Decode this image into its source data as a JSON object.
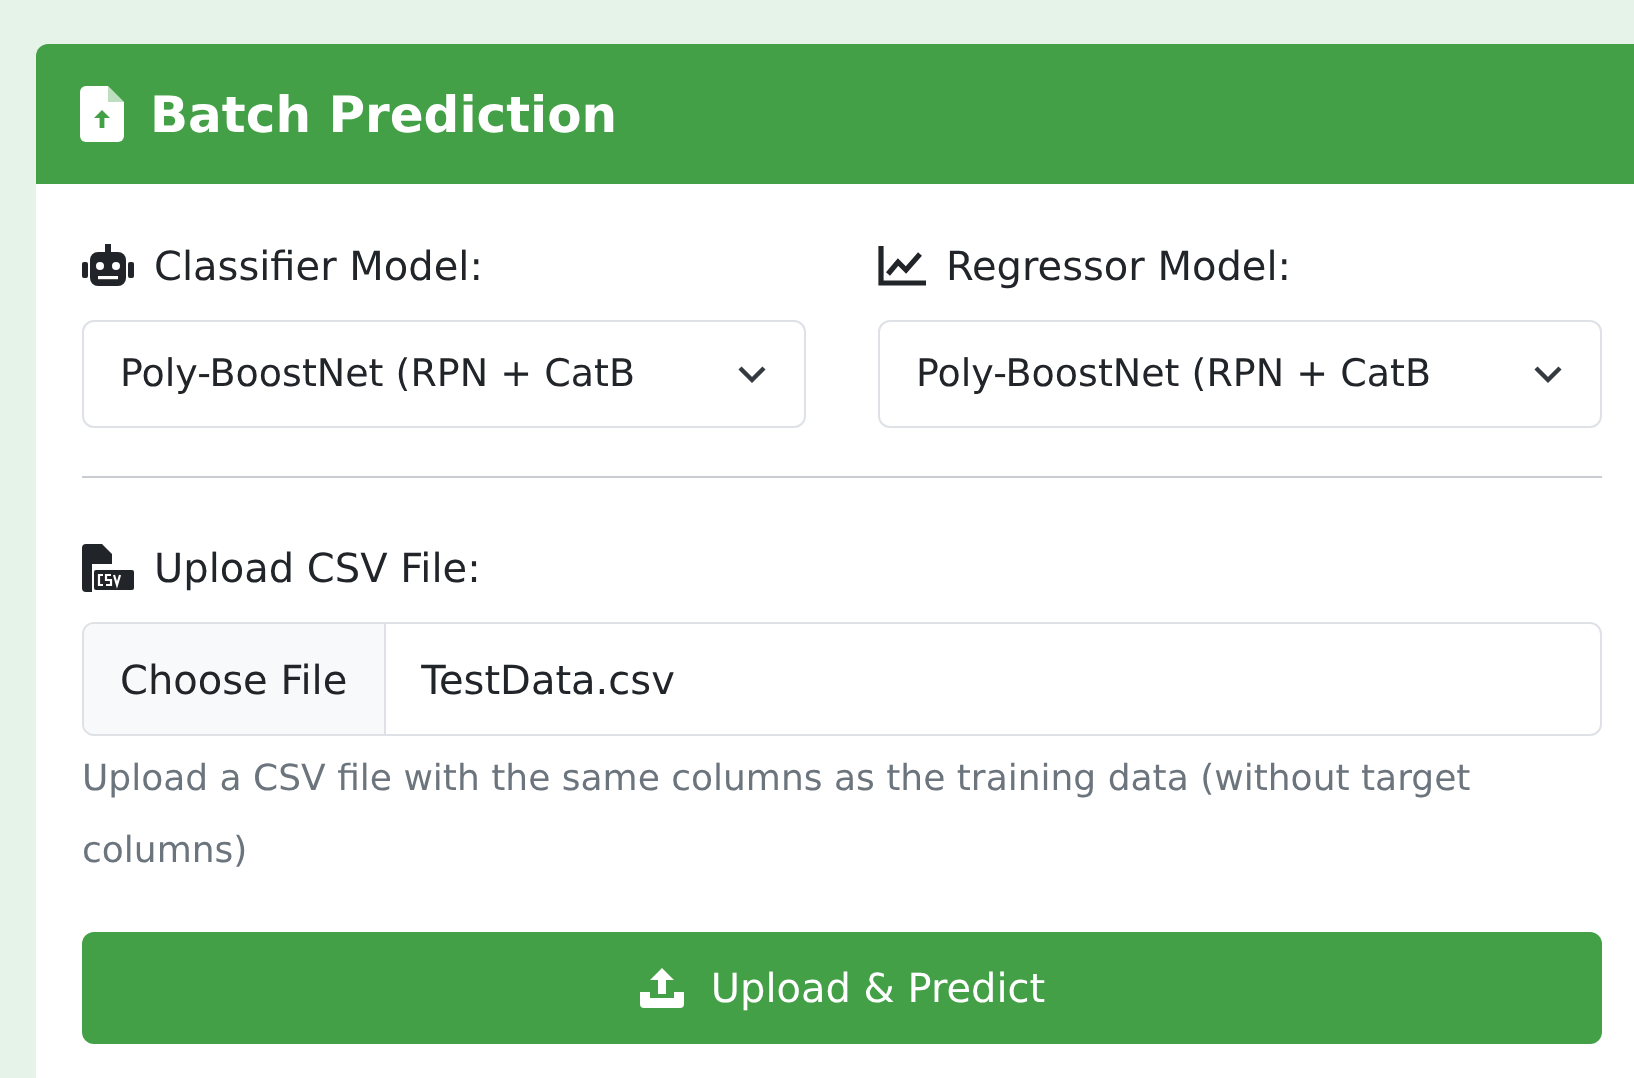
{
  "card": {
    "title": "Batch Prediction"
  },
  "selects": [
    {
      "label": "Classifier Model:",
      "value": "Poly-BoostNet (RPN + CatB"
    },
    {
      "label": "Regressor Model:",
      "value": "Poly-BoostNet (RPN + CatB"
    }
  ],
  "upload": {
    "label": "Upload CSV File:",
    "button": "Choose File",
    "value": "TestData.csv",
    "help": "Upload a CSV file with the same columns as the training data (without target columns)"
  },
  "submit": {
    "label": "Upload & Predict"
  }
}
